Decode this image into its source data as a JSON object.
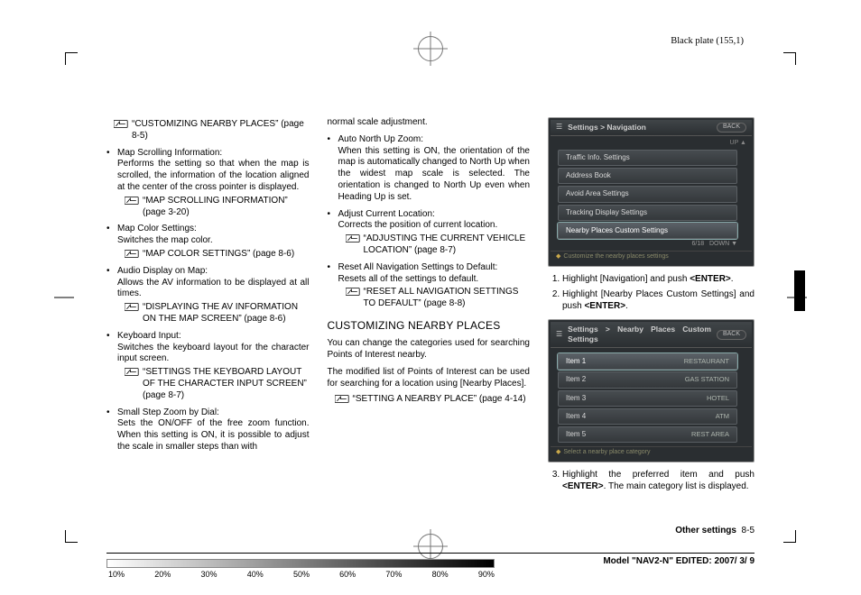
{
  "plate_label": "Black plate (155,1)",
  "col1": {
    "ref0": "“CUSTOMIZING NEARBY PLACES” (page 8-5)",
    "b1_title": "Map Scrolling Information:",
    "b1_desc": "Performs the setting so that when the map is scrolled, the information of the location aligned at the center of the cross pointer is displayed.",
    "b1_ref": "“MAP SCROLLING INFORMATION” (page 3-20)",
    "b2_title": "Map Color Settings:",
    "b2_desc": "Switches the map color.",
    "b2_ref": "“MAP COLOR SETTINGS” (page 8-6)",
    "b3_title": "Audio Display on Map:",
    "b3_desc": "Allows the AV information to be displayed at all times.",
    "b3_ref": "“DISPLAYING THE AV INFORMATION ON THE MAP SCREEN” (page 8-6)",
    "b4_title": "Keyboard Input:",
    "b4_desc": "Switches the keyboard layout for the character input screen.",
    "b4_ref": "“SETTINGS THE KEYBOARD LAYOUT OF THE CHARACTER INPUT SCREEN” (page 8-7)",
    "b5_title": "Small Step Zoom by Dial:",
    "b5_desc": "Sets the ON/OFF of the free zoom function. When this setting is ON, it is possible to adjust the scale in smaller steps than with"
  },
  "col2": {
    "cont": "normal scale adjustment.",
    "b1_title": "Auto North Up Zoom:",
    "b1_desc": "When this setting is ON, the orientation of the map is automatically changed to North Up when the widest map scale is selected. The orientation is changed to North Up even when Heading Up is set.",
    "b2_title": "Adjust Current Location:",
    "b2_desc": "Corrects the position of current location.",
    "b2_ref": "“ADJUSTING THE CURRENT VEHICLE LOCATION” (page 8-7)",
    "b3_title": "Reset All Navigation Settings to Default:",
    "b3_desc": "Resets all of the settings to default.",
    "b3_ref": "“RESET ALL NAVIGATION SETTINGS TO DEFAULT” (page 8-8)",
    "heading": "CUSTOMIZING NEARBY PLACES",
    "p1": "You can change the categories used for searching Points of Interest nearby.",
    "p2": "The modified list of Points of Interest can be used for searching for a location using [Nearby Places].",
    "p_ref": "“SETTING A NEARBY PLACE” (page 4-14)"
  },
  "col3": {
    "ss1": {
      "crumb": "Settings > Navigation",
      "back": "BACK",
      "rows": [
        "Traffic Info. Settings",
        "Address Book",
        "Avoid Area Settings",
        "Tracking Display Settings",
        "Nearby Places Custom Settings"
      ],
      "count": "6/18",
      "foot": "Customize the nearby places settings"
    },
    "step1": "Highlight [Navigation] and push ",
    "step1b": "<ENTER>",
    "step2": "Highlight [Nearby Places Custom Settings] and push ",
    "step2b": "<ENTER>",
    "ss2": {
      "crumb": "Settings > Nearby Places Custom Settings",
      "back": "BACK",
      "rows": [
        {
          "l": "Item 1",
          "r": "RESTAURANT"
        },
        {
          "l": "Item 2",
          "r": "GAS STATION"
        },
        {
          "l": "Item 3",
          "r": "HOTEL"
        },
        {
          "l": "Item 4",
          "r": "ATM"
        },
        {
          "l": "Item 5",
          "r": "REST AREA"
        }
      ],
      "foot": "Select a nearby place category"
    },
    "step3a": "Highlight the preferred item and push ",
    "step3b": "<ENTER>",
    "step3c": ". The main category list is displayed."
  },
  "footer": {
    "section_label": "Other settings",
    "page": "8-5"
  },
  "model_line": "Model \"NAV2-N\" EDITED: 2007/ 3/ 9",
  "gradient_labels": [
    "10%",
    "20%",
    "30%",
    "40%",
    "50%",
    "60%",
    "70%",
    "80%",
    "90%"
  ]
}
